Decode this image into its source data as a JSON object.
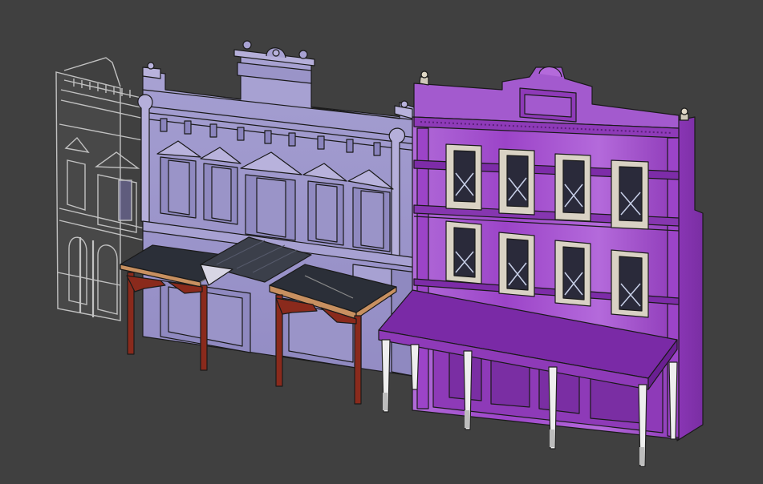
{
  "scene": {
    "background_color": "#404040",
    "outline_color": "#1a1a1a",
    "buildings": [
      {
        "name": "ghost-building-left",
        "style": "wireframe-translucent",
        "color": "#b8b8b8"
      },
      {
        "name": "lavender-building-middle",
        "style": "flat-shaded",
        "color": "#9a93c8"
      },
      {
        "name": "purple-building-right",
        "style": "glossy-shaded",
        "color": "#9b3fc4"
      }
    ],
    "verandahs": [
      {
        "name": "left-verandah",
        "roof_color": "#2b2f38",
        "post_color": "#8a2a1c",
        "trim_color": "#c89060"
      },
      {
        "name": "right-awning",
        "roof_color": "#7a2aa6",
        "post_color": "#e8e8e8"
      }
    ],
    "window_trim_color": "#d9d2c4",
    "window_glass_color": "#2a2a3a"
  }
}
